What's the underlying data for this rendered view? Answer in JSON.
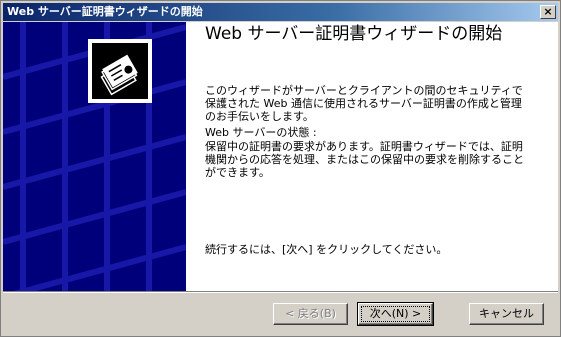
{
  "window": {
    "title": "Web サーバー証明書ウィザードの開始",
    "close_glyph": "×"
  },
  "wizard": {
    "heading": "Web サーバー証明書ウィザードの開始",
    "intro": "このウィザードがサーバーとクライアントの間のセキュリティで保護された Web 通信に使用されるサーバー証明書の作成と管理のお手伝いをします。",
    "status_label": "Web サーバーの状態 :",
    "status_text": "保留中の証明書の要求があります。証明書ウィザードでは、証明機関からの応答を処理、またはこの保留中の要求を削除することができます。",
    "continue_text": "続行するには、[次へ] をクリックしてください。"
  },
  "buttons": {
    "back": "< 戻る(B)",
    "next": "次へ(N) >",
    "cancel": "キャンセル"
  },
  "colors": {
    "banner_blue": "#00007b",
    "banner_grid": "#1010a0",
    "title_gradient_start": "#0a246a",
    "title_gradient_end": "#a6caf0",
    "dialog_face": "#d4d0c8"
  },
  "icons": {
    "banner_icon": "certificate-stack-icon"
  }
}
